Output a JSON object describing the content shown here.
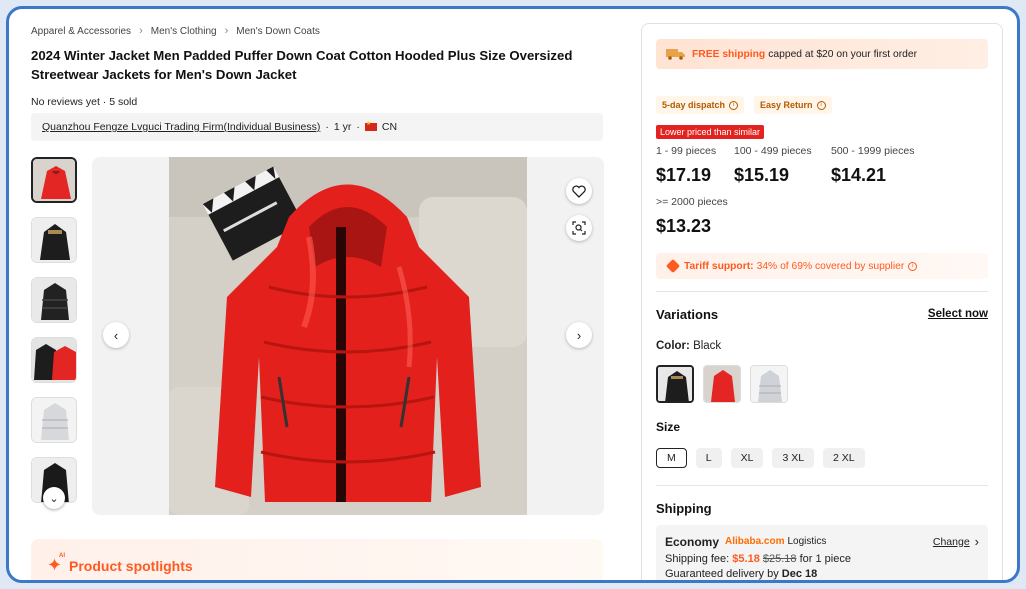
{
  "breadcrumb": [
    "Apparel & Accessories",
    "Men's Clothing",
    "Men's Down Coats"
  ],
  "product": {
    "title": "2024 Winter Jacket Men Padded Puffer Down Coat Cotton Hooded Plus Size Oversized Streetwear Jackets for Men's Down Jacket",
    "reviews": "No reviews yet",
    "dot": "·",
    "sold": "5 sold"
  },
  "supplier": {
    "name": "Quanzhou Fengze Lvguci Trading Firm(Individual Business)",
    "years": "1 yr",
    "country": "CN"
  },
  "gallery": {
    "thumbnails": [
      "red jacket",
      "black jacket",
      "black jacket",
      "black and red jackets",
      "white jacket",
      "black jacket"
    ],
    "selected_index": 0
  },
  "spotlight": {
    "label": "Product spotlights",
    "badge": "AI"
  },
  "shipping_banner": {
    "free": "FREE shipping",
    "rest": "capped at $20 on your first order"
  },
  "badges": [
    "5-day dispatch",
    "Easy Return"
  ],
  "lower_price_tag": "Lower priced than similar",
  "pricing": [
    {
      "range": "1 - 99 pieces",
      "price": "$17.19"
    },
    {
      "range": "100 - 499 pieces",
      "price": "$15.19"
    },
    {
      "range": "500 - 1999 pieces",
      "price": "$14.21"
    },
    {
      "range": ">= 2000 pieces",
      "price": "$13.23"
    }
  ],
  "tariff": {
    "label": "Tariff support:",
    "text": "34% of 69% covered by supplier"
  },
  "variations": {
    "title": "Variations",
    "select_now": "Select now",
    "color_label": "Color:",
    "color_value": "Black",
    "colors": [
      "Black",
      "Red",
      "White"
    ],
    "size_label": "Size",
    "sizes": [
      "M",
      "L",
      "XL",
      "3 XL",
      "2 XL"
    ],
    "selected_size": "M"
  },
  "shipping": {
    "title": "Shipping",
    "method": "Economy",
    "carrier_brand": "Alibaba.com",
    "carrier_suffix": "Logistics",
    "change": "Change",
    "fee_label": "Shipping fee:",
    "fee": "$5.18",
    "fee_old": "$25.18",
    "fee_unit": "for 1 piece",
    "delivery_label": "Guaranteed delivery by",
    "delivery_date": "Dec 18"
  },
  "colors": {
    "accent": "#ff5a1f",
    "brand_orange": "#ff6a00",
    "badge_red": "#e3231f",
    "frame_blue": "#3b78c8"
  }
}
